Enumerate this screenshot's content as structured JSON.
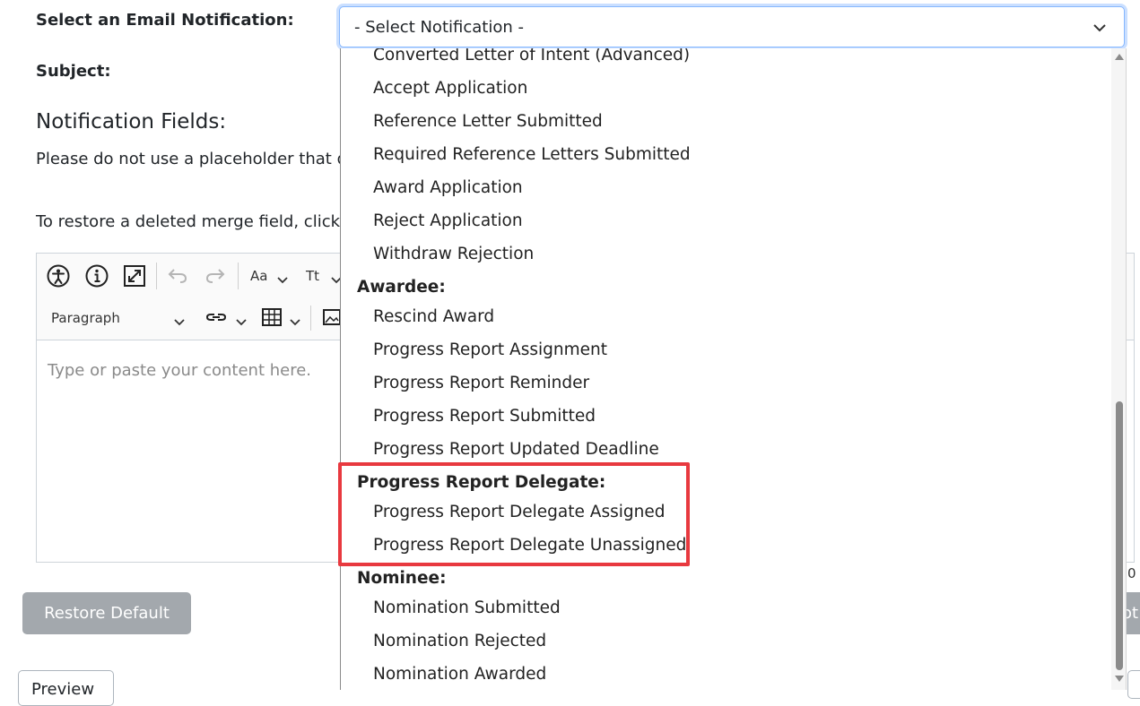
{
  "form": {
    "select_label": "Select an Email Notification:",
    "subject_label": "Subject:",
    "fields_heading": "Notification Fields:",
    "placeholder_note": "Please do not use a placeholder that d",
    "restore_note": "To restore a deleted merge field, click '",
    "select_value": "- Select Notification -"
  },
  "editor": {
    "font_size_label": "Aa",
    "font_family_label": "Tt",
    "heading_select": "Paragraph",
    "placeholder": "Type or paste your content here.",
    "counter_fragment": "0"
  },
  "buttons": {
    "restore_default": "Restore Default",
    "preview": "Preview",
    "right_fragment": "ot"
  },
  "dropdown": {
    "items_top": [
      "Converted Letter of Intent (Advanced)",
      "Accept Application",
      "Reference Letter Submitted",
      "Required Reference Letters Submitted",
      "Award Application",
      "Reject Application",
      "Withdraw Rejection"
    ],
    "group_awardee": "Awardee:",
    "awardee_items": [
      "Rescind Award",
      "Progress Report Assignment",
      "Progress Report Reminder",
      "Progress Report Submitted",
      "Progress Report Updated Deadline"
    ],
    "group_delegate": "Progress Report Delegate:",
    "delegate_items": [
      "Progress Report Delegate Assigned",
      "Progress Report Delegate Unassigned"
    ],
    "group_nominee": "Nominee:",
    "nominee_items": [
      "Nomination Submitted",
      "Nomination Rejected",
      "Nomination Awarded"
    ]
  },
  "colors": {
    "highlight": "#e8393f",
    "focus_border": "#86b7fe",
    "button_gray": "#a3a8ad"
  }
}
